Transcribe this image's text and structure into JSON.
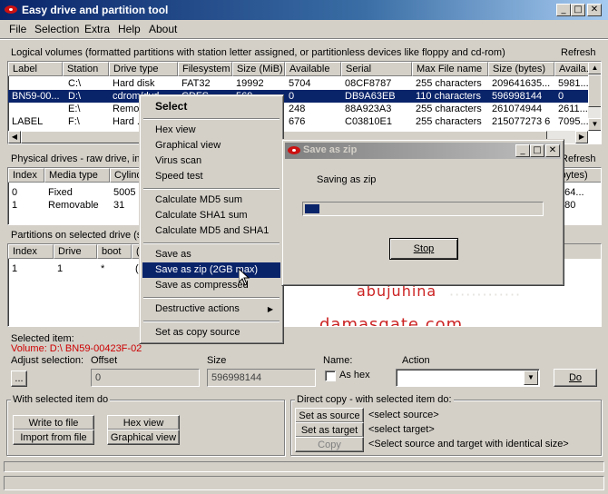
{
  "window": {
    "title": "Easy drive and partition tool"
  },
  "menu": [
    "File",
    "Selection",
    "Extra",
    "Help",
    "About"
  ],
  "logical": {
    "label": "Logical volumes (formatted partitions with station letter assigned, or partitionless devices like floppy and cd-rom)",
    "refresh": "Refresh",
    "columns": [
      "Label",
      "Station",
      "Drive type",
      "Filesystem",
      "Size (MiB)",
      "Available",
      "Serial",
      "Max File name",
      "Size (bytes)",
      "Availa..."
    ],
    "rows": [
      [
        "",
        "C:\\",
        "Hard disk",
        "FAT32",
        "19992",
        "5704",
        "08CF8787",
        "255 characters",
        "209641635...",
        "5981..."
      ],
      [
        "BN59-00...",
        "D:\\",
        "cdrom/dvd",
        "CDFS",
        "569",
        "0",
        "DB9A63EB",
        "110 characters",
        "596998144",
        "0"
      ],
      [
        "",
        "E:\\",
        "Remo...",
        "",
        "",
        "248",
        "88A923A3",
        "255 characters",
        "261074944",
        "2611..."
      ],
      [
        "LABEL",
        "F:\\",
        "Hard ...",
        "",
        "",
        "676",
        "C03810E1",
        "255 characters",
        "215077273 6",
        "7095..."
      ]
    ]
  },
  "physical": {
    "label": "Physical drives - raw drive, inc...",
    "refresh": "Refresh",
    "columns": [
      "Index",
      "Media type",
      "Cylinders",
      "(bytes)"
    ],
    "rows": [
      [
        "0",
        "Fixed",
        "5005",
        "...64..."
      ],
      [
        "1",
        "Removable",
        "31",
        "...80"
      ]
    ]
  },
  "partitions": {
    "label": "Partitions on selected drive (s...",
    "columns": [
      "Index",
      "Drive",
      "boot",
      "("
    ],
    "rows": [
      [
        "1",
        "1",
        "*",
        "("
      ]
    ]
  },
  "context_menu": {
    "title": "Select",
    "items": [
      "Hex view",
      "Graphical view",
      "Virus scan",
      "Speed test",
      "Calculate MD5 sum",
      "Calculate SHA1 sum",
      "Calculate MD5 and SHA1",
      "Save as",
      "Save as zip (2GB max)",
      "Save as compressed",
      "Destructive actions",
      "Set as copy source"
    ]
  },
  "dialog": {
    "title": "Save as zip",
    "message": "Saving as zip",
    "progress": 0.06,
    "stop_label": "Stop"
  },
  "watermark": {
    "line1": "abujuhina",
    "line2": "damasgate.com"
  },
  "selected": {
    "label": "Selected item:",
    "volume": "Volume: D:\\ BN59-00423F-02",
    "adjust_label": "Adjust selection:",
    "browse_label": "...",
    "offset_label": "Offset",
    "offset_value": "0",
    "size_label": "Size",
    "size_value": "596998144",
    "name_label": "Name:",
    "as_hex_label": "As hex",
    "action_label": "Action",
    "do_label": "Do"
  },
  "with_selected": {
    "label": "With selected item do",
    "write_to_file": "Write to file",
    "import_from_file": "Import from file",
    "hex_view": "Hex view",
    "graphical_view": "Graphical view"
  },
  "direct_copy": {
    "label": "Direct copy - with selected item do:",
    "set_as_source": "Set as source",
    "set_as_target": "Set as target",
    "copy": "Copy",
    "source_text": "<select source>",
    "target_text": "<select target>",
    "hint": "<Select source and target with identical size>"
  },
  "colors": {
    "titlebar": "#0a246a",
    "selection": "#0a246a",
    "volume_red": "#cc0000",
    "watermark_red": "#cc2222"
  }
}
